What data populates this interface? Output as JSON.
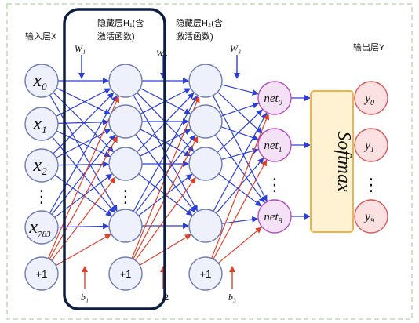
{
  "labels": {
    "input_layer": "输入层X",
    "hidden1_line1": "隐藏层H₁(含",
    "hidden1_line2": "激活函数)",
    "hidden2_line1": "隐藏层H₂(含",
    "hidden2_line2": "激活函数)",
    "output_layer": "输出层Y",
    "w1": "W₁",
    "w2": "W₂",
    "w3": "W₃",
    "b1": "b₁",
    "b2": "2",
    "b3": "b₃",
    "softmax": "Softmax"
  },
  "input_nodes": [
    {
      "base": "x",
      "sub": "0"
    },
    {
      "base": "x",
      "sub": "1"
    },
    {
      "base": "x",
      "sub": "2"
    },
    {
      "base": "⋮",
      "sub": ""
    },
    {
      "base": "x",
      "sub": "783"
    },
    {
      "base": "+1",
      "sub": ""
    }
  ],
  "hidden1_nodes": [
    "",
    "",
    "",
    "⋮",
    "",
    "+1"
  ],
  "hidden2_nodes": [
    "",
    "",
    "",
    "",
    "+1"
  ],
  "net_nodes": [
    {
      "base": "net",
      "sub": "0"
    },
    {
      "base": "net",
      "sub": "1"
    },
    {
      "base": "⋮",
      "sub": ""
    },
    {
      "base": "net",
      "sub": "9"
    }
  ],
  "output_nodes": [
    {
      "base": "y",
      "sub": "0"
    },
    {
      "base": "y",
      "sub": "1"
    },
    {
      "base": "⋮",
      "sub": ""
    },
    {
      "base": "y",
      "sub": "9"
    }
  ],
  "colors": {
    "weight_edge": "#2b3fd6",
    "bias_edge": "#e0402a",
    "node_fill": "#eef1fb",
    "node_stroke": "#6e7bb5",
    "net_fill": "#f5e1f6",
    "net_stroke": "#b24fc0",
    "out_fill": "#fbe1e1",
    "out_stroke": "#d75a5a",
    "softmax_fill": "#fff2d2",
    "softmax_stroke": "#f0b34a",
    "highlight_box": "#0e1e40"
  }
}
